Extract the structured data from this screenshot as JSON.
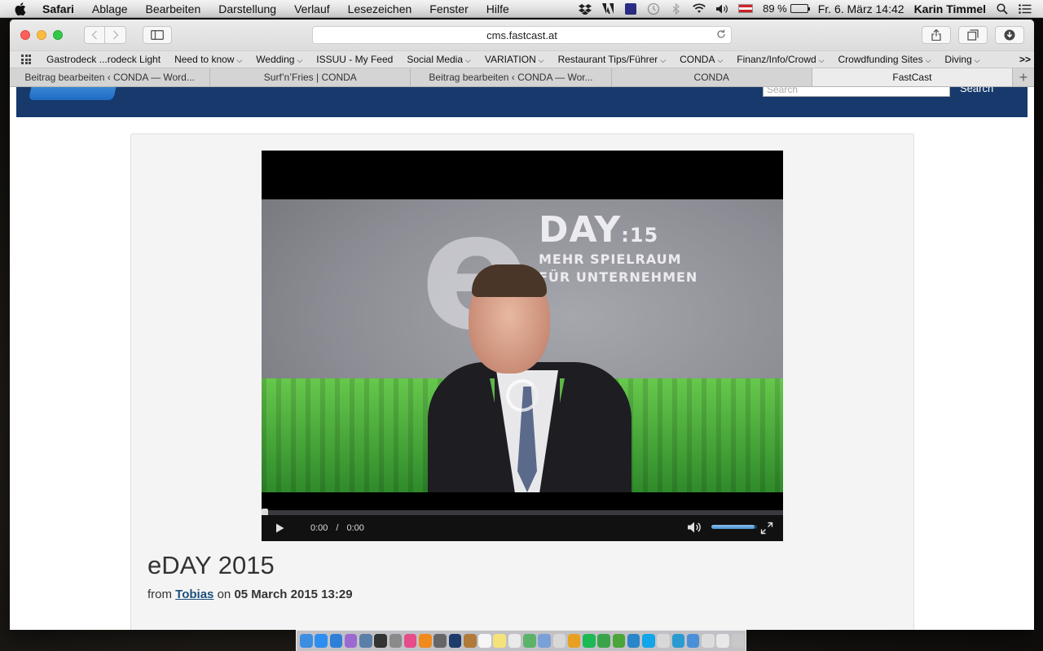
{
  "menubar": {
    "app_name": "Safari",
    "items": [
      "Ablage",
      "Bearbeiten",
      "Darstellung",
      "Verlauf",
      "Lesezeichen",
      "Fenster",
      "Hilfe"
    ],
    "battery_percent": "89 %",
    "battery_level": 0.89,
    "datetime": "Fr. 6. März  14:42",
    "user": "Karin Timmel"
  },
  "browser": {
    "address": "cms.fastcast.at",
    "bookmarks": [
      {
        "label": "Gastrodeck ...rodeck Light",
        "menu": false
      },
      {
        "label": "Need to know",
        "menu": true
      },
      {
        "label": "Wedding",
        "menu": true
      },
      {
        "label": "ISSUU - My Feed",
        "menu": false
      },
      {
        "label": "Social Media",
        "menu": true
      },
      {
        "label": "VARIATION",
        "menu": true
      },
      {
        "label": "Restaurant Tips/Führer",
        "menu": true
      },
      {
        "label": "CONDA",
        "menu": true
      },
      {
        "label": "Finanz/Info/Crowd",
        "menu": true
      },
      {
        "label": "Crowdfunding Sites",
        "menu": true
      },
      {
        "label": "Diving",
        "menu": true
      }
    ],
    "bookmarks_more": ">>",
    "tabs": [
      {
        "label": "Beitrag bearbeiten ‹ CONDA — Word...",
        "active": false
      },
      {
        "label": "Surf’n’Fries | CONDA",
        "active": false
      },
      {
        "label": "Beitrag bearbeiten ‹ CONDA — Wor...",
        "active": false
      },
      {
        "label": "CONDA",
        "active": false
      },
      {
        "label": "FastCast",
        "active": true
      }
    ]
  },
  "site": {
    "search_placeholder": "Search",
    "search_button": "Search"
  },
  "video": {
    "banner_day": "DAY",
    "banner_year": ":15",
    "banner_line1": "MEHR SPIELRAUM",
    "banner_line2": "FÜR UNTERNEHMEN",
    "time_current": "0:00",
    "time_separator": "/",
    "time_total": "0:00",
    "progress": 0.0,
    "volume": 0.95
  },
  "post": {
    "title": "eDAY 2015",
    "by_prefix": "from",
    "author": "Tobias",
    "on_word": "on",
    "date": "05 March 2015 13:29"
  },
  "colors": {
    "site_header": "#17396b",
    "author_link": "#1d4f7d"
  },
  "dock_icons": [
    {
      "name": "finder",
      "color": "#3b8ee0"
    },
    {
      "name": "safari",
      "color": "#2d8ef0"
    },
    {
      "name": "app-store",
      "color": "#2f7fd8"
    },
    {
      "name": "photos",
      "color": "#9b6ad0"
    },
    {
      "name": "preview",
      "color": "#5b7fa8"
    },
    {
      "name": "dashboard",
      "color": "#333333"
    },
    {
      "name": "system-prefs",
      "color": "#8a8a8a"
    },
    {
      "name": "itunes",
      "color": "#e64b8a"
    },
    {
      "name": "ibooks",
      "color": "#f08a1c"
    },
    {
      "name": "time-machine",
      "color": "#666666"
    },
    {
      "name": "photoshop",
      "color": "#1b3b6b"
    },
    {
      "name": "notes-brown",
      "color": "#b07a3a"
    },
    {
      "name": "calendar",
      "color": "#f5f5f5"
    },
    {
      "name": "notes",
      "color": "#f6e27a"
    },
    {
      "name": "reminders",
      "color": "#eaeaea"
    },
    {
      "name": "maps",
      "color": "#5bb36a"
    },
    {
      "name": "mail",
      "color": "#7aa0d8"
    },
    {
      "name": "preview-2",
      "color": "#d8d8d8"
    },
    {
      "name": "keynote",
      "color": "#e8a020"
    },
    {
      "name": "spotify",
      "color": "#1db954"
    },
    {
      "name": "numbers",
      "color": "#3aa44a"
    },
    {
      "name": "evernote",
      "color": "#4ba53a"
    },
    {
      "name": "tweetdeck",
      "color": "#2a86c8"
    },
    {
      "name": "skype",
      "color": "#12a5e8"
    },
    {
      "name": "generic-1",
      "color": "#d8d8d8"
    },
    {
      "name": "lotus",
      "color": "#2a9ad0"
    },
    {
      "name": "generic-2",
      "color": "#4a90d8"
    },
    {
      "name": "downloads",
      "color": "#dcdcdc"
    },
    {
      "name": "documents",
      "color": "#e8e8e8"
    },
    {
      "name": "trash",
      "color": "#c8c8c8"
    }
  ]
}
